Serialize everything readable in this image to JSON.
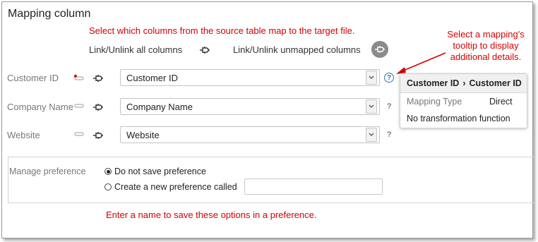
{
  "panel": {
    "title": "Mapping column"
  },
  "annotations": {
    "top": "Select which columns from the source table map to the target file.",
    "tooltip_line1": "Select a mapping's",
    "tooltip_line2": "tooltip to display",
    "tooltip_line3": "additional details.",
    "bottom": "Enter a name to save these options in a preference."
  },
  "links": {
    "link_all": "Link/Unlink all columns",
    "link_unmapped": "Link/Unlink unmapped columns"
  },
  "rows": [
    {
      "label": "Customer ID",
      "value": "Customer ID",
      "help": "?"
    },
    {
      "label": "Company Name",
      "value": "Company Name",
      "help": "?"
    },
    {
      "label": "Website",
      "value": "Website",
      "help": "?"
    }
  ],
  "tooltip": {
    "source": "Customer ID",
    "separator": "›",
    "target": "Customer ID",
    "type_label": "Mapping Type",
    "type_value": "Direct",
    "transform": "No transformation function"
  },
  "preference": {
    "label": "Manage preference",
    "option_no_save": "Do not save preference",
    "option_create": "Create a new preference called",
    "selected": "Do not save preference",
    "name_value": ""
  },
  "colors": {
    "annotation": "#d40000",
    "help": "#2f6fb5"
  },
  "icons": [
    "plug-icon",
    "key-icon",
    "field-icon",
    "chevron-down-icon",
    "help-icon",
    "arrow-icon"
  ]
}
